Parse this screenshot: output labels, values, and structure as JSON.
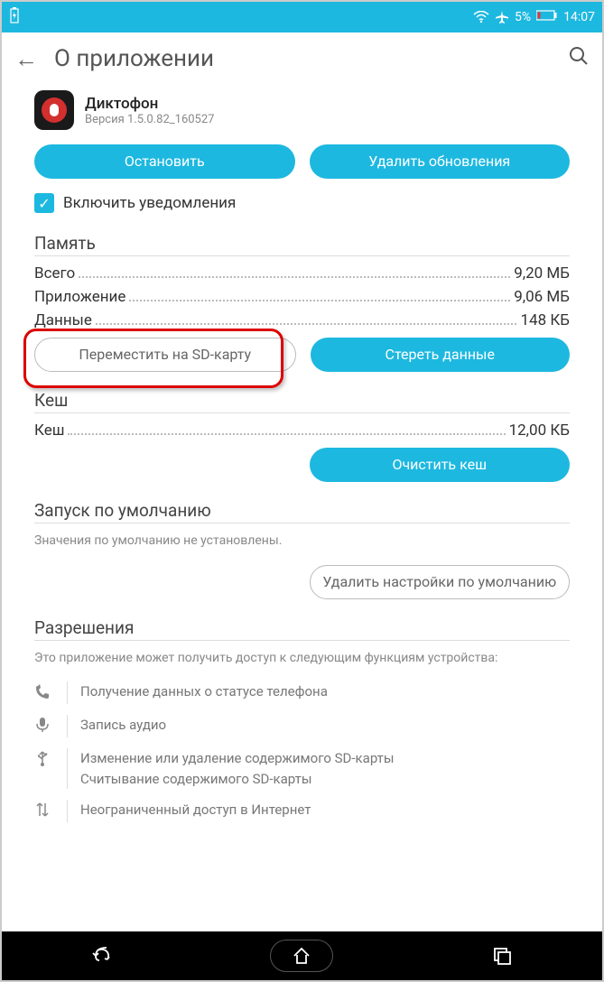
{
  "status": {
    "battery_pct": "5%",
    "time": "14:07"
  },
  "header": {
    "title": "О приложении"
  },
  "app": {
    "name": "Диктофон",
    "version": "Версия 1.5.0.82_160527"
  },
  "buttons": {
    "stop": "Остановить",
    "delete_updates": "Удалить обновления",
    "move_sd": "Переместить на SD-карту",
    "clear_data": "Стереть данные",
    "clear_cache": "Очистить кеш",
    "clear_defaults": "Удалить настройки по умолчанию"
  },
  "checkbox": {
    "notifications": "Включить уведомления"
  },
  "memory": {
    "title": "Память",
    "rows": {
      "total_l": "Всего",
      "total_v": "9,20 МБ",
      "app_l": "Приложение",
      "app_v": "9,06 МБ",
      "data_l": "Данные",
      "data_v": "148 КБ"
    }
  },
  "cache": {
    "title": "Кеш",
    "rows": {
      "cache_l": "Кеш",
      "cache_v": "12,00 КБ"
    }
  },
  "defaults": {
    "title": "Запуск по умолчанию",
    "sub": "Значения по умолчанию не установлены."
  },
  "permissions": {
    "title": "Разрешения",
    "sub": "Это приложение может получить доступ к следующим функциям устройства:",
    "items": {
      "phone": "Получение данных о статусе телефона",
      "mic": "Запись аудио",
      "sd1": "Изменение или удаление содержимого SD-карты",
      "sd2": "Считывание содержимого SD-карты",
      "net": "Неограниченный доступ в Интернет"
    }
  }
}
